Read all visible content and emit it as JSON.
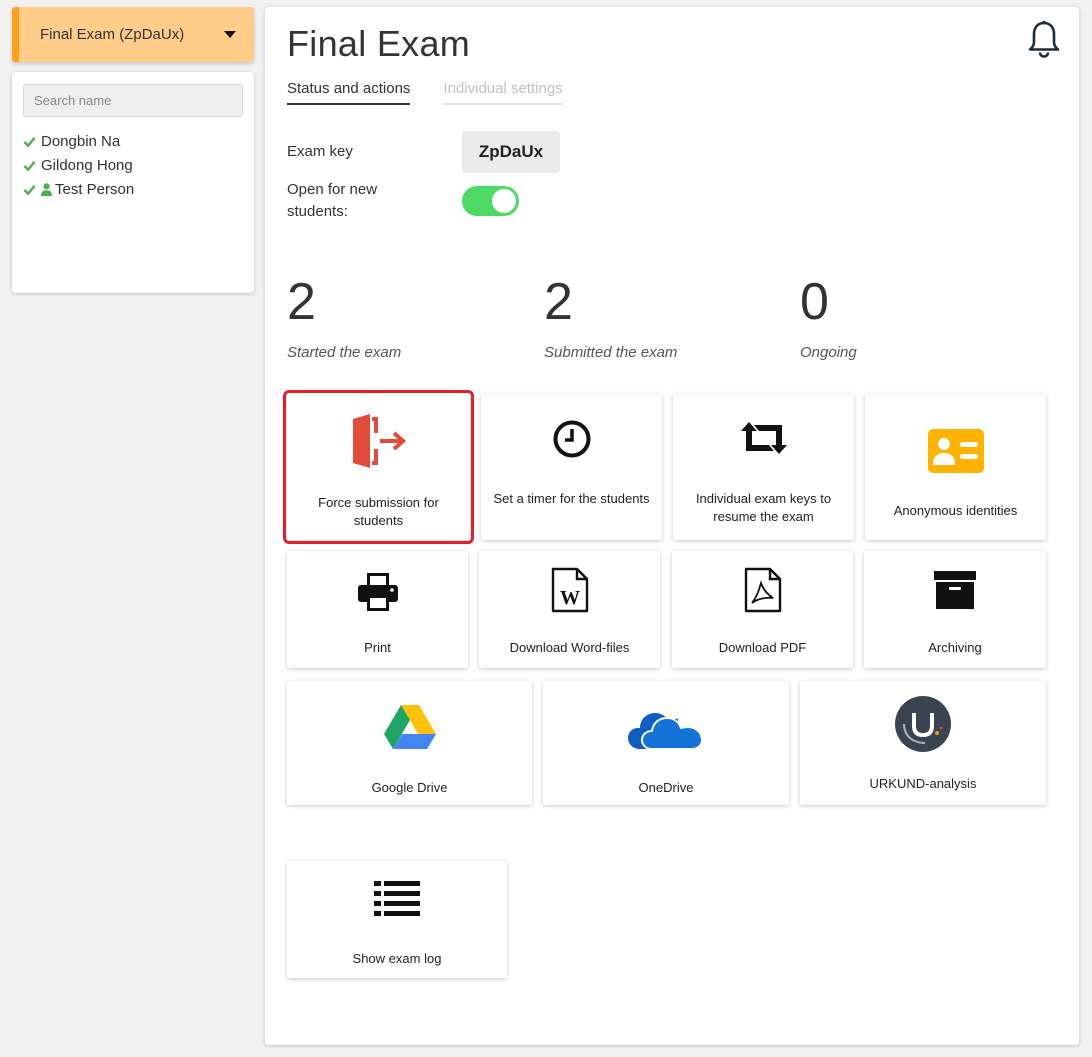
{
  "exam_selector": {
    "label": "Final Exam (ZpDaUx)"
  },
  "students": {
    "search_placeholder": "Search name",
    "items": [
      {
        "name": "Dongbin Na",
        "status": "submitted"
      },
      {
        "name": "Gildong Hong",
        "status": "submitted"
      },
      {
        "name": "Test Person",
        "status": "submitted",
        "is_test": true
      }
    ]
  },
  "header": {
    "title": "Final Exam"
  },
  "tabs": [
    {
      "label": "Status and actions",
      "active": true
    },
    {
      "label": "Individual settings",
      "active": false
    }
  ],
  "settings": {
    "exam_key_label": "Exam key",
    "exam_key_value": "ZpDaUx",
    "open_label": "Open for new students:",
    "open_value": true
  },
  "stats": [
    {
      "value": "2",
      "caption": "Started the exam"
    },
    {
      "value": "2",
      "caption": "Submitted the exam"
    },
    {
      "value": "0",
      "caption": "Ongoing"
    }
  ],
  "actions": {
    "force_submission": "Force submission for students",
    "set_timer": "Set a timer for the students",
    "individual_keys": "Individual exam keys to resume the exam",
    "anonymous": "Anonymous identities",
    "print": "Print",
    "download_word": "Download Word-files",
    "download_pdf": "Download PDF",
    "archiving": "Archiving",
    "google_drive": "Google Drive",
    "onedrive": "OneDrive",
    "urkund": "URKUND-analysis",
    "exam_log": "Show exam log"
  },
  "colors": {
    "accent_orange": "#ff9f1a",
    "selector_bg": "#ffcc8a",
    "toggle_on": "#4cd964",
    "check_green": "#4caf50",
    "force_icon": "#e04b3a",
    "anonymous_icon": "#ffb300",
    "highlight": "#e0202b"
  },
  "icons": {
    "force_submission": "exit-door-icon",
    "set_timer": "clock-icon",
    "individual_keys": "retweet-icon",
    "anonymous": "id-card-icon",
    "print": "printer-icon",
    "download_word": "word-file-icon",
    "download_pdf": "pdf-file-icon",
    "archiving": "archive-box-icon",
    "google_drive": "google-drive-icon",
    "onedrive": "onedrive-cloud-icon",
    "urkund": "urkund-logo-icon",
    "exam_log": "list-icon"
  }
}
